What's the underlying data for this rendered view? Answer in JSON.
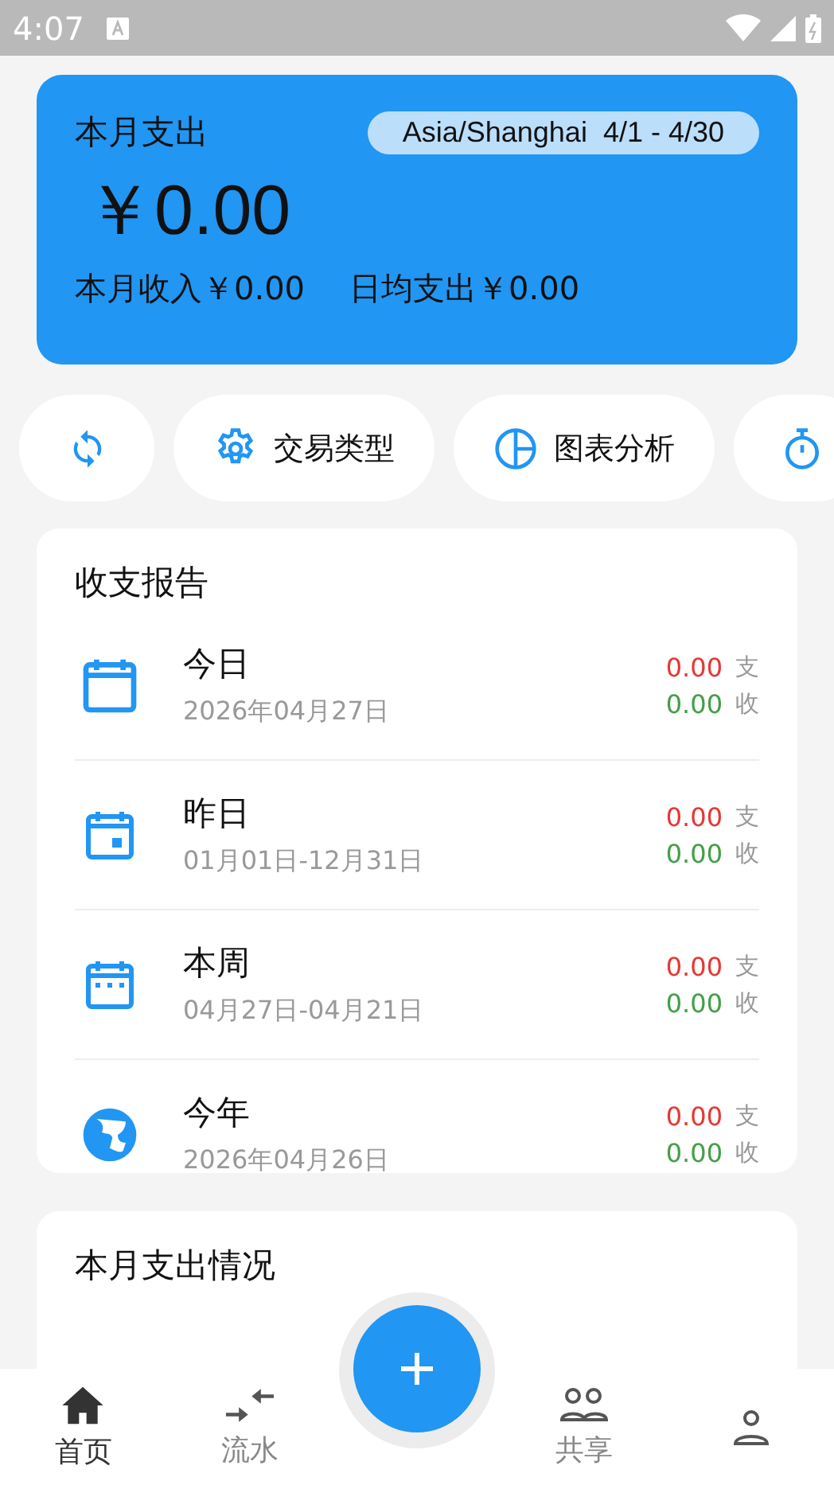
{
  "status_bar": {
    "time": "4:07"
  },
  "summary": {
    "title": "本月支出",
    "period": "Asia/Shanghai  4/1 - 4/30",
    "amount": "￥0.00",
    "income": "本月收入￥0.00",
    "daily_average": "日均支出￥0.00"
  },
  "shortcuts": [
    {
      "kind": "refresh"
    },
    {
      "kind": "settings",
      "label": "交易类型"
    },
    {
      "kind": "chart",
      "label": "图表分析"
    },
    {
      "kind": "timer"
    }
  ],
  "report": {
    "title": "收支报告",
    "rows": [
      {
        "kind": "calendar",
        "title": "今日",
        "date": "2026年04月27日",
        "expense": "0.00",
        "expense_label": "支",
        "income": "0.00",
        "income_label": "收"
      },
      {
        "kind": "calendar-day",
        "title": "昨日",
        "date": "01月01日-12月31日",
        "expense": "0.00",
        "expense_label": "支",
        "income": "0.00",
        "income_label": "收"
      },
      {
        "kind": "calendar-week",
        "title": "本周",
        "date": "04月27日-04月21日",
        "expense": "0.00",
        "expense_label": "支",
        "income": "0.00",
        "income_label": "收"
      },
      {
        "kind": "globe",
        "title": "今年",
        "date": "2026年04月26日",
        "expense": "0.00",
        "expense_label": "支",
        "income": "0.00",
        "income_label": "收"
      }
    ]
  },
  "monthly": {
    "title": "本月支出情况"
  },
  "nav": [
    {
      "kind": "home",
      "label": "首页",
      "selected": true
    },
    {
      "kind": "transfer",
      "label": "流水",
      "selected": false
    },
    {
      "kind": "add"
    },
    {
      "kind": "people",
      "label": "共享",
      "selected": false
    },
    {
      "kind": "person",
      "selected": false
    }
  ]
}
